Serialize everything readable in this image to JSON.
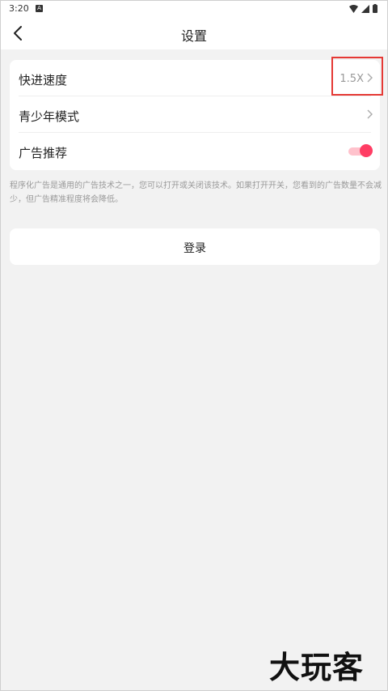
{
  "status_bar": {
    "time": "3:20",
    "notice": "A"
  },
  "header": {
    "title": "设置",
    "back_icon": "chevron-left-icon"
  },
  "settings": {
    "rows": [
      {
        "label": "快进速度",
        "value": "1.5X"
      },
      {
        "label": "青少年模式",
        "value": ""
      },
      {
        "label": "广告推荐",
        "toggle_on": true
      }
    ]
  },
  "ad_note": "程序化广告是通用的广告技术之一，您可以打开或关闭该技术。如果打开开关，您看到的广告数量不会减少，但广告精准程度将会降低。",
  "login_label": "登录",
  "watermark": "大玩客",
  "colors": {
    "accent": "#ff3d64",
    "highlight": "#e53935",
    "background": "#f2f2f2"
  }
}
